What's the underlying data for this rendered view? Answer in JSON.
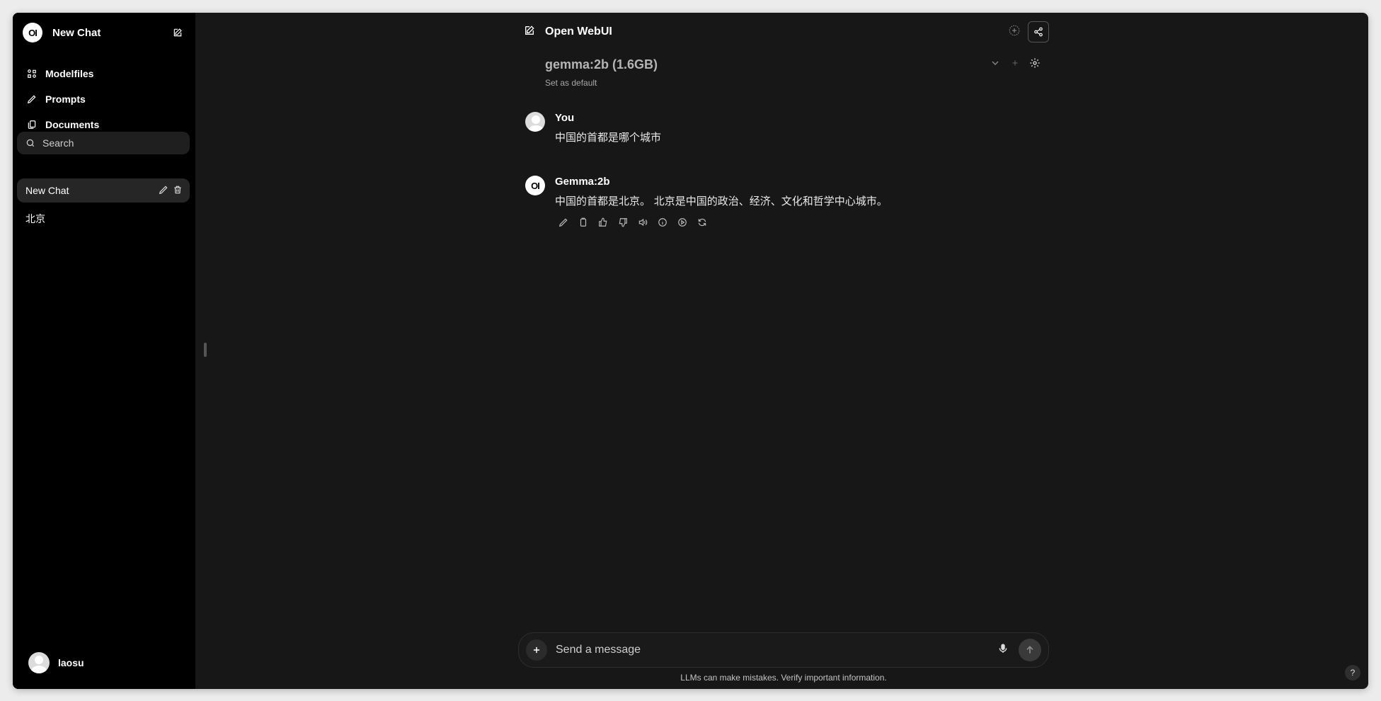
{
  "sidebar": {
    "logo_text": "OI",
    "new_chat_label": "New Chat",
    "nav": [
      {
        "label": "Modelfiles",
        "icon": "modelfiles-icon"
      },
      {
        "label": "Prompts",
        "icon": "pencil-icon"
      },
      {
        "label": "Documents",
        "icon": "documents-icon"
      }
    ],
    "search_placeholder": "Search",
    "chats": [
      {
        "label": "New Chat",
        "active": true
      },
      {
        "label": "北京",
        "active": false
      }
    ],
    "user_name": "laosu"
  },
  "header": {
    "title": "Open WebUI"
  },
  "model": {
    "name": "gemma:2b (1.6GB)",
    "set_default_label": "Set as default"
  },
  "messages": [
    {
      "sender": "You",
      "text": "中国的首都是哪个城市"
    },
    {
      "sender": "Gemma:2b",
      "text": "中国的首都是北京。 北京是中国的政治、经济、文化和哲学中心城市。"
    }
  ],
  "composer": {
    "placeholder": "Send a message"
  },
  "disclaimer": "LLMs can make mistakes. Verify important information.",
  "help_label": "?",
  "colors": {
    "sidebar_bg": "#000000",
    "main_bg": "#171717",
    "active_chat_bg": "#262626"
  }
}
